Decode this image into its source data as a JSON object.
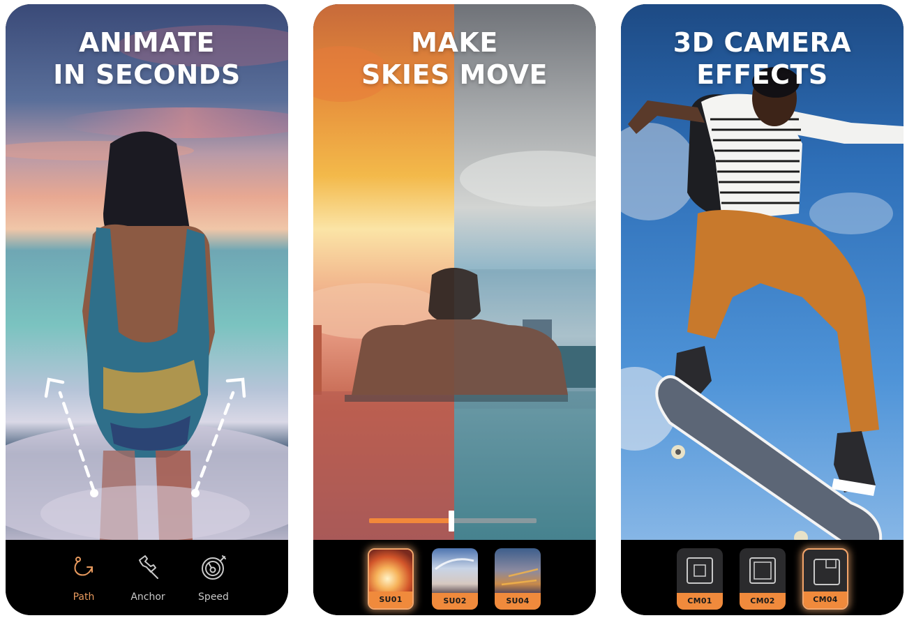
{
  "colors": {
    "accent": "#f08a3c",
    "active_tool": "#e89a5e",
    "inactive_tool": "#c9c9c9",
    "bar_bg": "#000000",
    "thumb_bg": "#2b2b2d"
  },
  "panels": [
    {
      "headline": [
        "ANIMATE",
        "IN SECONDS"
      ],
      "toolbar": [
        {
          "label": "Path",
          "icon": "path-icon",
          "active": true
        },
        {
          "label": "Anchor",
          "icon": "pin-icon",
          "active": false
        },
        {
          "label": "Speed",
          "icon": "speedometer-icon",
          "active": false
        }
      ]
    },
    {
      "headline": [
        "MAKE",
        "SKIES MOVE"
      ],
      "slider": {
        "value_fraction": 0.49
      },
      "presets": [
        {
          "label": "SU01",
          "selected": true
        },
        {
          "label": "SU02",
          "selected": false
        },
        {
          "label": "SU04",
          "selected": false
        }
      ]
    },
    {
      "headline": [
        "3D CAMERA",
        "EFFECTS"
      ],
      "presets": [
        {
          "label": "CM01",
          "icon": "zoom-in-square-icon",
          "selected": false
        },
        {
          "label": "CM02",
          "icon": "zoom-out-square-icon",
          "selected": false
        },
        {
          "label": "CM04",
          "icon": "pan-corner-square-icon",
          "selected": true
        }
      ]
    }
  ]
}
